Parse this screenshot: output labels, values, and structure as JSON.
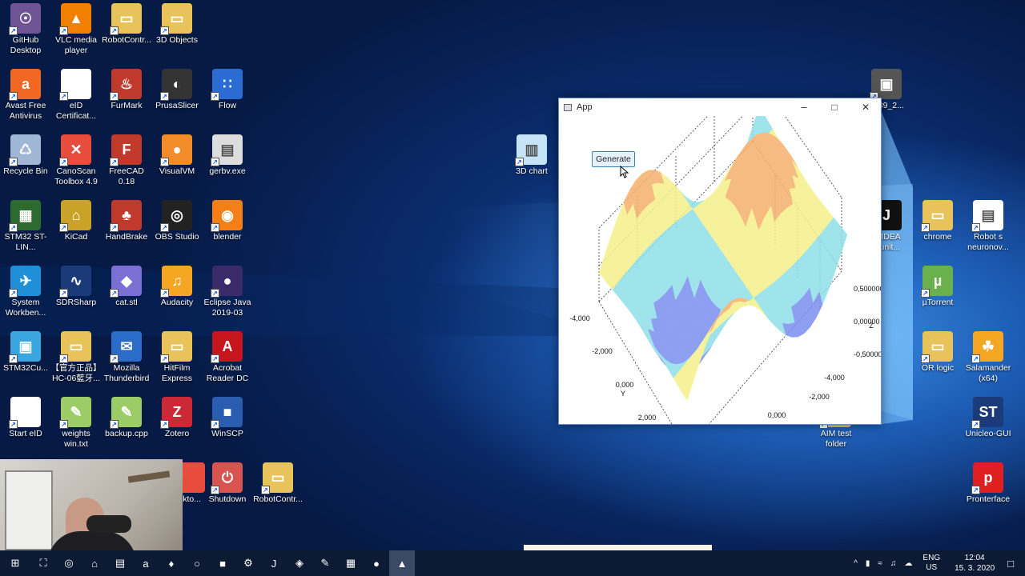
{
  "desktop_icons": [
    {
      "label": "GitHub Desktop",
      "color": "#6e5494",
      "glyph": "☉"
    },
    {
      "label": "VLC media player",
      "color": "#f08000",
      "glyph": "▲"
    },
    {
      "label": "RobotContr...",
      "color": "#e8c35a",
      "glyph": "▭"
    },
    {
      "label": "3D Objects",
      "color": "#e8c35a",
      "glyph": "▭"
    },
    {
      "label": "Avast Free Antivirus",
      "color": "#f26722",
      "glyph": "a"
    },
    {
      "label": "eID Certificat...",
      "color": "#ffffff",
      "glyph": ""
    },
    {
      "label": "FurMark",
      "color": "#c0392b",
      "glyph": "♨"
    },
    {
      "label": "PrusaSlicer",
      "color": "#333333",
      "glyph": "◐"
    },
    {
      "label": "Flow",
      "color": "#2b6cd4",
      "glyph": "∷"
    },
    {
      "label": "Recycle Bin",
      "color": "#9fb7d4",
      "glyph": "♺"
    },
    {
      "label": "CanoScan Toolbox 4.9",
      "color": "#e74c3c",
      "glyph": "✕"
    },
    {
      "label": "FreeCAD 0.18",
      "color": "#c0392b",
      "glyph": "F"
    },
    {
      "label": "VisualVM",
      "color": "#f28c28",
      "glyph": "●"
    },
    {
      "label": "gerbv.exe",
      "color": "#dddddd",
      "glyph": "▤"
    },
    {
      "label": "STM32 ST-LIN...",
      "color": "#2d6a2d",
      "glyph": "▦"
    },
    {
      "label": "KiCad",
      "color": "#c9a227",
      "glyph": "⌂"
    },
    {
      "label": "HandBrake",
      "color": "#c0392b",
      "glyph": "♣"
    },
    {
      "label": "OBS Studio",
      "color": "#222222",
      "glyph": "◎"
    },
    {
      "label": "blender",
      "color": "#f57f17",
      "glyph": "◉"
    },
    {
      "label": "System Workben...",
      "color": "#1f8fd9",
      "glyph": "✈"
    },
    {
      "label": "SDRSharp",
      "color": "#1a3a7a",
      "glyph": "∿"
    },
    {
      "label": "cat.stl",
      "color": "#7b6fd4",
      "glyph": "◆"
    },
    {
      "label": "Audacity",
      "color": "#f5a623",
      "glyph": "♫"
    },
    {
      "label": "Eclipse Java 2019-03",
      "color": "#3a2a6a",
      "glyph": "●"
    },
    {
      "label": "STM32Cu...",
      "color": "#3aa6e0",
      "glyph": "▣"
    },
    {
      "label": "【官方正品】 HC-06藍牙...",
      "color": "#e8c35a",
      "glyph": "▭"
    },
    {
      "label": "Mozilla Thunderbird",
      "color": "#2a6cc8",
      "glyph": "✉"
    },
    {
      "label": "HitFilm Express",
      "color": "#e8c35a",
      "glyph": "▭"
    },
    {
      "label": "Acrobat Reader DC",
      "color": "#c4161c",
      "glyph": "A"
    },
    {
      "label": "Start eID",
      "color": "#ffffff",
      "glyph": ""
    },
    {
      "label": "weights win.txt",
      "color": "#9ccc65",
      "glyph": "✎"
    },
    {
      "label": "backup.cpp",
      "color": "#9ccc65",
      "glyph": "✎"
    },
    {
      "label": "Zotero",
      "color": "#cc2936",
      "glyph": "Z"
    },
    {
      "label": "WinSCP",
      "color": "#2a5db0",
      "glyph": "■"
    },
    {
      "label": "Shutdown",
      "color": "#d9534f",
      "glyph": "⏻"
    },
    {
      "label": "RobotContr...",
      "color": "#e8c35a",
      "glyph": "▭"
    },
    {
      "label": "skto...",
      "color": "#e74c3c",
      "glyph": ""
    },
    {
      "label": "3D chart",
      "color": "#c6e4f7",
      "glyph": "▥"
    },
    {
      "label": "5339_2...",
      "color": "#555555",
      "glyph": "▣"
    },
    {
      "label": "IJ IDEA munit...",
      "color": "#111111",
      "glyph": "J"
    },
    {
      "label": "chrome",
      "color": "#e8c35a",
      "glyph": "▭"
    },
    {
      "label": "Robot s neuronov...",
      "color": "#ffffff",
      "glyph": "▤"
    },
    {
      "label": "µTorrent",
      "color": "#6ab04c",
      "glyph": "µ"
    },
    {
      "label": "OR logic",
      "color": "#e8c35a",
      "glyph": "▭"
    },
    {
      "label": "Salamander (x64)",
      "color": "#f5a623",
      "glyph": "☘"
    },
    {
      "label": "Unicleo-GUI",
      "color": "#1a3a7a",
      "glyph": "ST"
    },
    {
      "label": "AIM test folder",
      "color": "#e8c35a",
      "glyph": "▭"
    },
    {
      "label": "Pronterface",
      "color": "#e02020",
      "glyph": "p"
    }
  ],
  "app_window": {
    "title": "App",
    "minimize": "–",
    "maximize": "□",
    "close": "✕",
    "generate_label": "Generate"
  },
  "chart_data": {
    "type": "surface",
    "title": "",
    "xlabel": "X",
    "ylabel": "Y",
    "zlabel": "Z",
    "x_ticks": [
      "-4,000",
      "-2,000",
      "0,000",
      "2,000"
    ],
    "y_ticks": [
      "-4,000",
      "-2,000",
      "0,000",
      "2,000"
    ],
    "z_ticks": [
      "0,500000",
      "0,00000",
      "-0,50000"
    ],
    "x_range": [
      -4,
      4
    ],
    "y_range": [
      -4,
      4
    ],
    "z_range": [
      -1,
      1
    ],
    "colormap": [
      "#7b8ff0",
      "#8fe0e8",
      "#f5f08a",
      "#f5b06a",
      "#e86a6a"
    ]
  },
  "taskbar": {
    "pinned": [
      "⊞",
      "⛶",
      "◎",
      "⌂",
      "▤",
      "a",
      "♦",
      "○",
      "■",
      "⚙",
      "J",
      "◈",
      "✎",
      "▦",
      "●",
      "▲"
    ],
    "lang": "ENG",
    "region": "US",
    "time": "12:04",
    "date": "15. 3. 2020"
  },
  "colors": {
    "taskbar": "#0c1a33",
    "window_border": "#6b8fc9",
    "button_border": "#3c7fb1"
  }
}
